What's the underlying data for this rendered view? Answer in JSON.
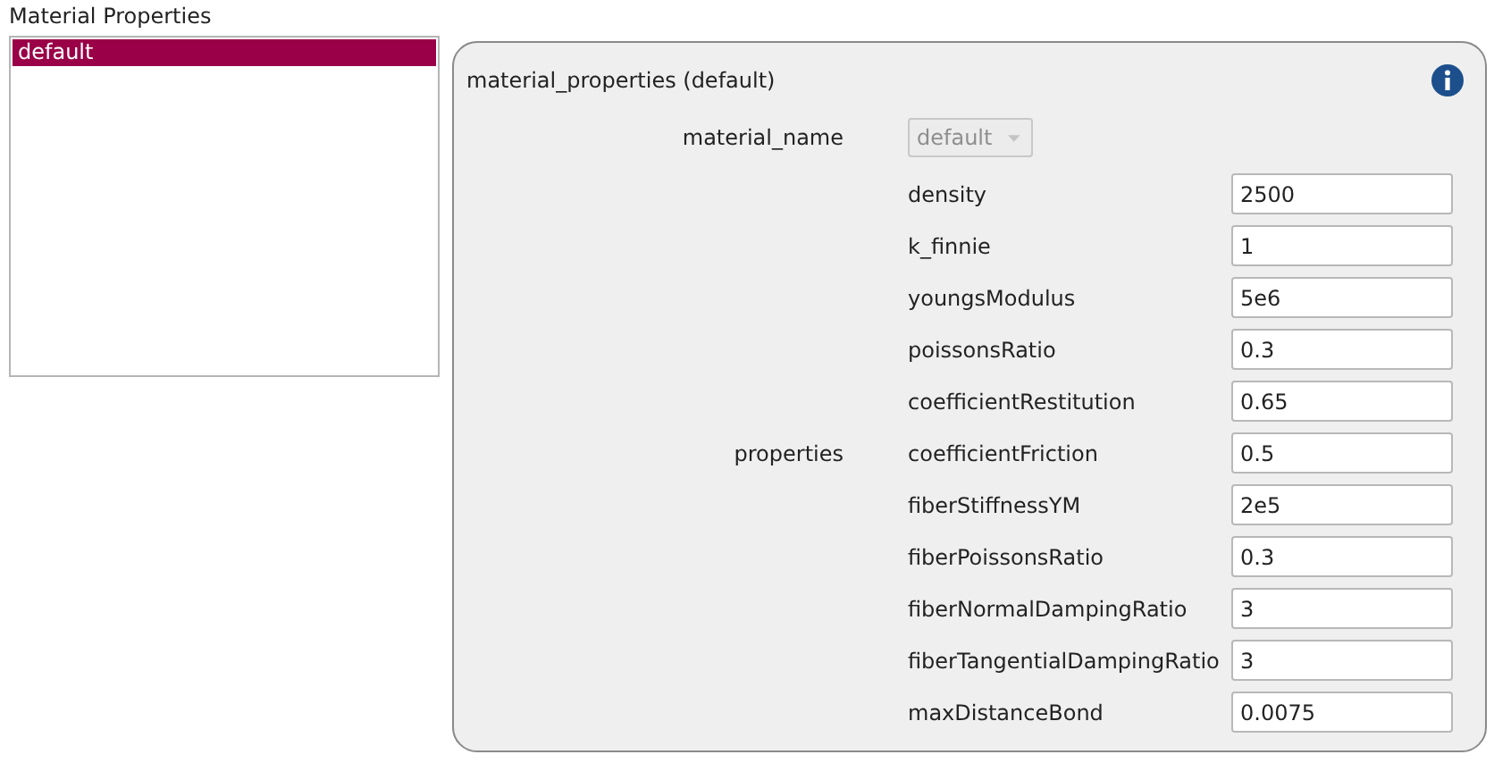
{
  "section_title": "Material Properties",
  "materials": [
    {
      "label": "default",
      "selected": true
    }
  ],
  "panel": {
    "title": "material_properties (default)",
    "material_name": {
      "label": "material_name",
      "value": "default",
      "disabled": true
    },
    "properties_label": "properties",
    "properties": [
      {
        "label": "density",
        "value": "2500"
      },
      {
        "label": "k_finnie",
        "value": "1"
      },
      {
        "label": "youngsModulus",
        "value": "5e6"
      },
      {
        "label": "poissonsRatio",
        "value": "0.3"
      },
      {
        "label": "coefficientRestitution",
        "value": "0.65"
      },
      {
        "label": "coefficientFriction",
        "value": "0.5"
      },
      {
        "label": "fiberStiffnessYM",
        "value": "2e5"
      },
      {
        "label": "fiberPoissonsRatio",
        "value": "0.3"
      },
      {
        "label": "fiberNormalDampingRatio",
        "value": "3"
      },
      {
        "label": "fiberTangentialDampingRatio",
        "value": "3"
      },
      {
        "label": "maxDistanceBond",
        "value": "0.0075"
      }
    ]
  }
}
